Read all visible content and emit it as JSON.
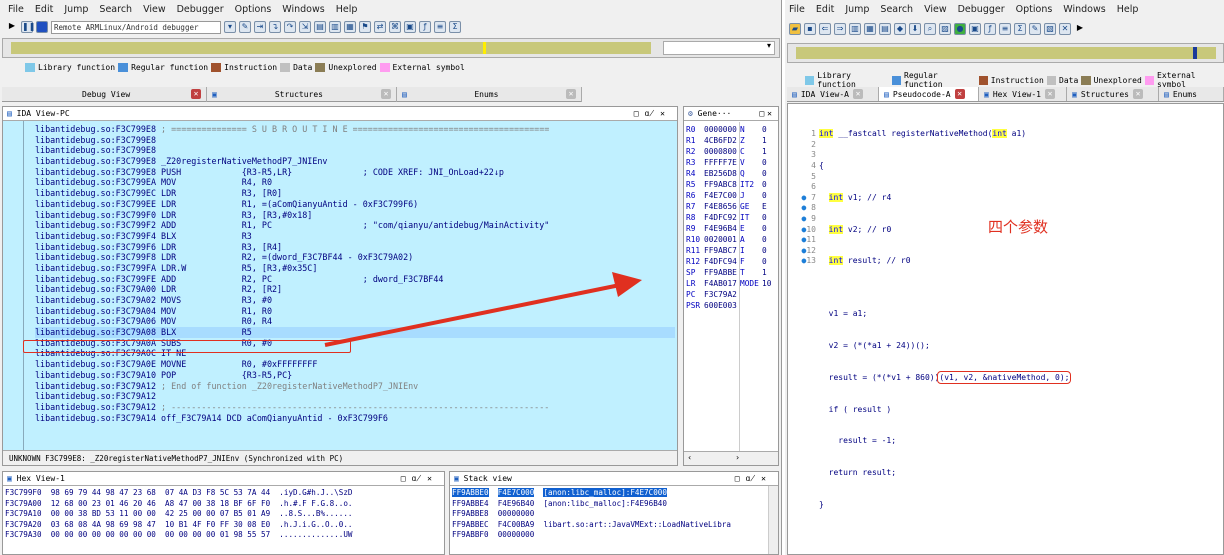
{
  "menu": [
    "File",
    "Edit",
    "Jump",
    "Search",
    "View",
    "Debugger",
    "Options",
    "Windows",
    "Help"
  ],
  "debugger_select": "Remote ARMLinux/Android debugger",
  "legend": [
    {
      "label": "Library function",
      "color": "#7fc8e8"
    },
    {
      "label": "Regular function",
      "color": "#4a90d9"
    },
    {
      "label": "Instruction",
      "color": "#a0522d"
    },
    {
      "label": "Data",
      "color": "#c0c0c0"
    },
    {
      "label": "Unexplored",
      "color": "#8b7d55"
    },
    {
      "label": "External symbol",
      "color": "#ff9cf0"
    }
  ],
  "left_tabs": [
    {
      "label": "Debug View"
    },
    {
      "label": "Structures"
    },
    {
      "label": "Enums"
    }
  ],
  "ida_view_title": "IDA View-PC",
  "asm_lines": [
    {
      "addr": "libantidebug.so:F3C799E8",
      "text": " ; =============== S U B R O U T I N E =======================================",
      "hl": false
    },
    {
      "addr": "libantidebug.so:F3C799E8",
      "text": "",
      "hl": false
    },
    {
      "addr": "libantidebug.so:F3C799E8",
      "text": "",
      "hl": false
    },
    {
      "addr": "libantidebug.so:F3C799E8",
      "text": " _Z20registerNativeMethodP7_JNIEnv",
      "hl": false
    },
    {
      "addr": "libantidebug.so:F3C799E8",
      "text": " PUSH            {R3-R5,LR}              ; CODE XREF: JNI_OnLoad+22↓p",
      "hl": false
    },
    {
      "addr": "libantidebug.so:F3C799EA",
      "text": " MOV             R4, R0",
      "hl": false
    },
    {
      "addr": "libantidebug.so:F3C799EC",
      "text": " LDR             R3, [R0]",
      "hl": false
    },
    {
      "addr": "libantidebug.so:F3C799EE",
      "text": " LDR             R1, =(aComQianyuAntid - 0xF3C799F6)",
      "hl": false
    },
    {
      "addr": "libantidebug.so:F3C799F0",
      "text": " LDR             R3, [R3,#0x18]",
      "hl": false
    },
    {
      "addr": "libantidebug.so:F3C799F2",
      "text": " ADD             R1, PC                  ; \"com/qianyu/antidebug/MainActivity\"",
      "hl": false
    },
    {
      "addr": "libantidebug.so:F3C799F4",
      "text": " BLX             R3",
      "hl": false
    },
    {
      "addr": "libantidebug.so:F3C799F6",
      "text": " LDR             R3, [R4]",
      "hl": false
    },
    {
      "addr": "libantidebug.so:F3C799F8",
      "text": " LDR             R2, =(dword_F3C7BF44 - 0xF3C79A02)",
      "hl": false
    },
    {
      "addr": "libantidebug.so:F3C799FA",
      "text": " LDR.W           R5, [R3,#0x35C]",
      "hl": false
    },
    {
      "addr": "libantidebug.so:F3C799FE",
      "text": " ADD             R2, PC                  ; dword_F3C7BF44",
      "hl": false
    },
    {
      "addr": "libantidebug.so:F3C79A00",
      "text": " LDR             R2, [R2]",
      "hl": false
    },
    {
      "addr": "libantidebug.so:F3C79A02",
      "text": " MOVS            R3, #0",
      "hl": false
    },
    {
      "addr": "libantidebug.so:F3C79A04",
      "text": " MOV             R1, R0",
      "hl": false
    },
    {
      "addr": "libantidebug.so:F3C79A06",
      "text": " MOV             R0, R4",
      "hl": false
    },
    {
      "addr": "libantidebug.so:F3C79A08",
      "text": " BLX             R5",
      "hl": true
    },
    {
      "addr": "libantidebug.so:F3C79A0A",
      "text": " SUBS            R0, #0",
      "hl": false
    },
    {
      "addr": "libantidebug.so:F3C79A0C",
      "text": " IT NE",
      "hl": false
    },
    {
      "addr": "libantidebug.so:F3C79A0E",
      "text": " MOVNE           R0, #0xFFFFFFFF",
      "hl": false
    },
    {
      "addr": "libantidebug.so:F3C79A10",
      "text": " POP             {R3-R5,PC}",
      "hl": false
    },
    {
      "addr": "libantidebug.so:F3C79A12",
      "text": " ; End of function _Z20registerNativeMethodP7_JNIEnv",
      "hl": false
    },
    {
      "addr": "libantidebug.so:F3C79A12",
      "text": "",
      "hl": false
    },
    {
      "addr": "libantidebug.so:F3C79A12",
      "text": " ; ---------------------------------------------------------------------------",
      "hl": false
    },
    {
      "addr": "libantidebug.so:F3C79A14",
      "text": " off_F3C79A14 DCD aComQianyuAntid - 0xF3C799F6",
      "hl": false
    }
  ],
  "ida_status": "UNKNOWN F3C799E8: _Z20registerNativeMethodP7_JNIEnv (Synchronized with PC)",
  "regs_title": "Gene···",
  "registers": [
    {
      "n": "R0",
      "v": "0000000",
      "f": "N",
      "b": "0"
    },
    {
      "n": "R1",
      "v": "4CB6FD2",
      "f": "Z",
      "b": "1"
    },
    {
      "n": "R2",
      "v": "0000800",
      "f": "C",
      "b": "1"
    },
    {
      "n": "R3",
      "v": "FFFFF7E",
      "f": "V",
      "b": "0"
    },
    {
      "n": "R4",
      "v": "EB256D8",
      "f": "Q",
      "b": "0"
    },
    {
      "n": "R5",
      "v": "FF9ABC8",
      "f": "IT2",
      "b": "0"
    },
    {
      "n": "R6",
      "v": "F4E7C00",
      "f": "J",
      "b": "0"
    },
    {
      "n": "R7",
      "v": "F4E8656",
      "f": "GE",
      "b": "E"
    },
    {
      "n": "R8",
      "v": "F4DFC92",
      "f": "IT",
      "b": "0"
    },
    {
      "n": "R9",
      "v": "F4E96B4",
      "f": "E",
      "b": "0"
    },
    {
      "n": "R10",
      "v": "0020001",
      "f": "A",
      "b": "0"
    },
    {
      "n": "R11",
      "v": "FF9ABC7",
      "f": "I",
      "b": "0"
    },
    {
      "n": "R12",
      "v": "F4DFC94",
      "f": "F",
      "b": "0"
    },
    {
      "n": "SP",
      "v": "FF9ABBE",
      "f": "T",
      "b": "1"
    },
    {
      "n": "LR",
      "v": "F4AB017",
      "f": "MODE",
      "b": "10"
    },
    {
      "n": "PC",
      "v": "F3C79A2",
      "f": "",
      "b": ""
    },
    {
      "n": "PSR",
      "v": "600E003",
      "f": "",
      "b": ""
    }
  ],
  "hex_title": "Hex View-1",
  "hex_lines": [
    "F3C799F0  98 69 79 44 98 47 23 68  07 4A D3 F8 5C 53 7A 44  .iyD.G#h.J..\\SzD",
    "F3C79A00  12 68 00 23 01 46 20 46  A8 47 00 38 18 BF 6F F0  .h.#.F F.G.8..o.",
    "F3C79A10  00 00 38 BD 53 11 00 00  42 25 00 00 07 B5 01 A9  ..8.S...B%......",
    "F3C79A20  03 68 08 4A 98 69 98 47  10 B1 4F F0 FF 30 08 E0  .h.J.i.G..O..0..",
    "F3C79A30  00 00 00 00 00 00 00 00  00 00 00 00 01 98 55 57  ..............UW"
  ],
  "stack_title": "Stack view",
  "stack_lines": [
    {
      "addr": "FF9ABBE0",
      "val": "F4E7C000",
      "note": "[anon:libc_malloc]:F4E7C000",
      "sel": true
    },
    {
      "addr": "FF9ABBE4",
      "val": "F4E96B40",
      "note": "[anon:libc_malloc]:F4E96B40",
      "sel": false
    },
    {
      "addr": "FF9ABBE8",
      "val": "00000000",
      "note": "",
      "sel": false
    },
    {
      "addr": "FF9ABBEC",
      "val": "F4C00BA9",
      "note": "libart.so:art::JavaVMExt::LoadNativeLibra",
      "sel": false
    },
    {
      "addr": "FF9ABBF0",
      "val": "00000000",
      "note": "",
      "sel": false
    }
  ],
  "right_tabs": [
    {
      "label": "IDA View-A"
    },
    {
      "label": "Pseudocode-A"
    },
    {
      "label": "Hex View-1"
    },
    {
      "label": "Structures"
    },
    {
      "label": "Enums"
    }
  ],
  "pseudo": {
    "l1_kw": "int",
    "l1_rest": " __fastcall registerNativeMethod(",
    "l1_kw2": "int",
    "l1_end": " a1)",
    "l2": "{",
    "l3_kw": "int",
    "l3_rest": " v1; // r4",
    "l4_kw": "int",
    "l4_rest": " v2; // r0",
    "l5_kw": "int",
    "l5_rest": " result; // r0",
    "l6": "",
    "l7": "  v1 = a1;",
    "l8": "  v2 = (*(*a1 + 24))();",
    "l9a": "  result = (*(*v1 + 860))",
    "l9b": "(v1, v2, &nativeMethod, 0);",
    "l10": "  if ( result )",
    "l11": "    result = -1;",
    "l12": "  return result;",
    "l13": "}"
  },
  "annotation": "四个参数",
  "colors": {
    "accent_red": "#e03020",
    "code_bg": "#c0f0ff"
  }
}
